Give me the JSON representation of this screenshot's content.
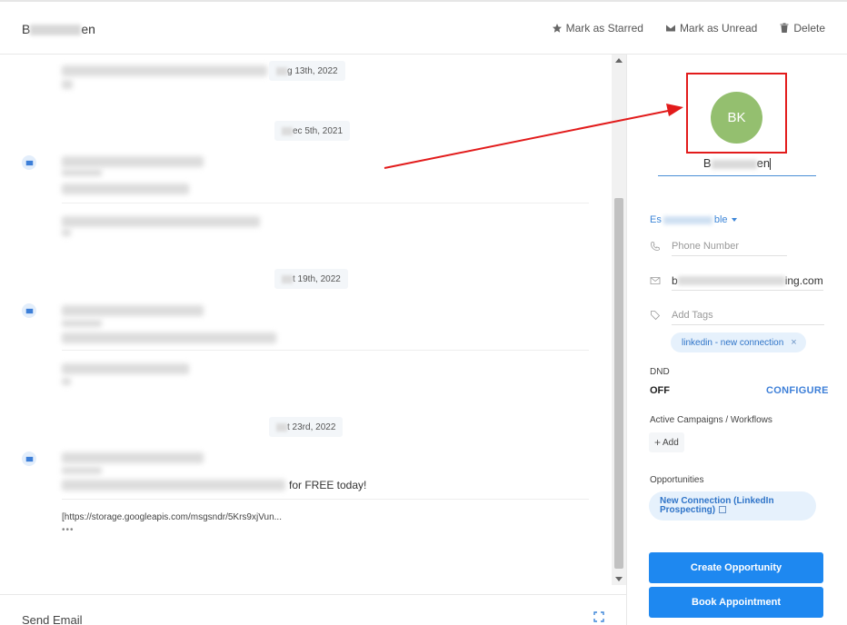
{
  "header": {
    "contact_name_start": "B",
    "contact_name_end": "en",
    "actions": [
      {
        "label": "Mark as Starred",
        "icon": "star-icon"
      },
      {
        "label": "Mark as Unread",
        "icon": "envelope-icon"
      },
      {
        "label": "Delete",
        "icon": "trash-icon"
      }
    ]
  },
  "conversation": {
    "dates": [
      {
        "suffix": "g 13th, 2022"
      },
      {
        "suffix": "ec 5th, 2021"
      },
      {
        "suffix": "t 19th, 2022"
      },
      {
        "suffix": "t 23rd, 2022"
      }
    ],
    "last_message_text": "for FREE today!",
    "link_text": "[https://storage.googleapis.com/msgsndr/5Krs9xjVun...",
    "more_indicator": "•••"
  },
  "composer": {
    "label": "Send Email"
  },
  "contact": {
    "avatar_initials": "BK",
    "name_start": "B",
    "name_end": "en",
    "owner_prefix": "Es",
    "owner_suffix": "ble",
    "phone_placeholder": "Phone Number",
    "email_start": "b",
    "email_end": "ing.com",
    "tags_placeholder": "Add Tags",
    "tags": [
      "linkedin - new connection"
    ],
    "tag_remove": "×",
    "dnd_label": "DND",
    "dnd_value": "OFF",
    "configure_label": "CONFIGURE",
    "campaigns_label": "Active Campaigns / Workflows",
    "add_label": "Add",
    "opportunities_label": "Opportunities",
    "opportunity_name": "New Connection (LinkedIn Prospecting)",
    "create_opportunity_label": "Create Opportunity",
    "book_appointment_label": "Book Appointment"
  },
  "colors": {
    "accent": "#1e88f0",
    "avatar": "#94bf6f",
    "annotation": "#e21b1b"
  }
}
